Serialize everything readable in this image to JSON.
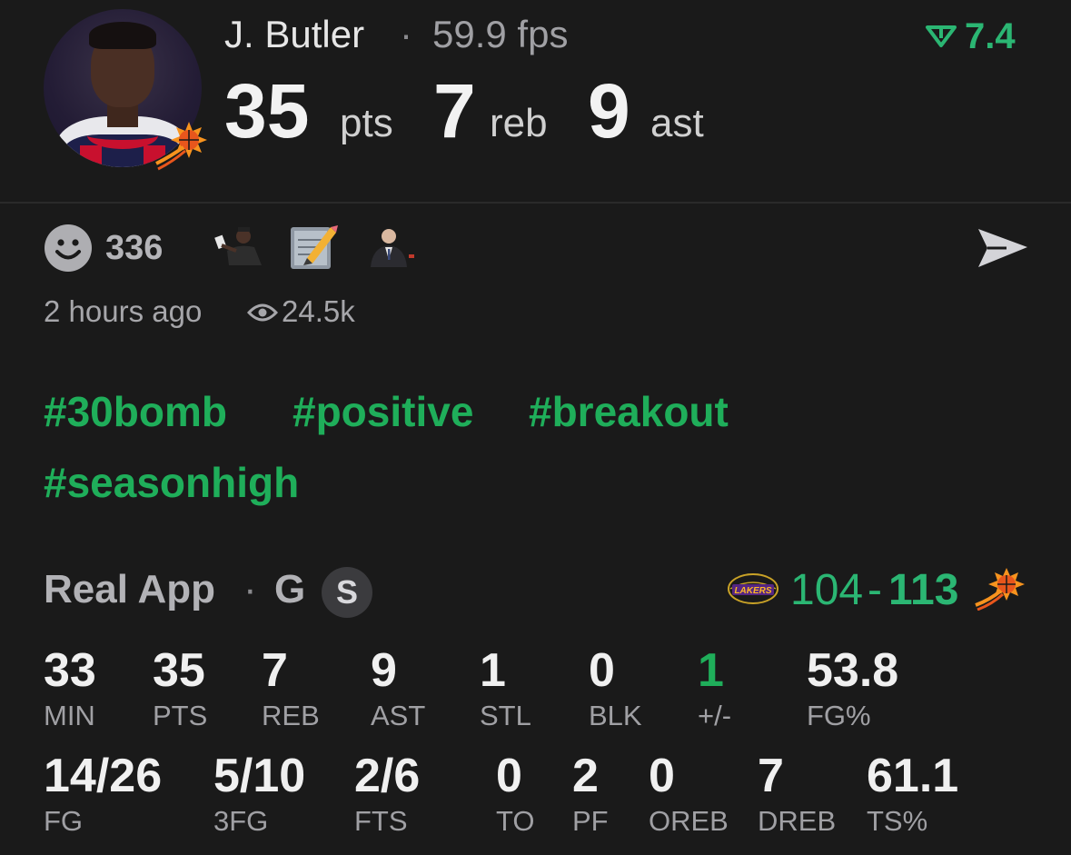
{
  "player": {
    "name": "J. Butler",
    "fps": "59.9 fps",
    "pts": "35",
    "pts_unit": "pts",
    "reb": "7",
    "reb_unit": "reb",
    "ast": "9",
    "ast_unit": "ast"
  },
  "rating": "7.4",
  "reactions": {
    "count": "336",
    "icons": [
      "smiley-icon",
      "player-reaction-emoji",
      "memo-emoji",
      "commissioner-emoji"
    ]
  },
  "meta": {
    "time_ago": "2 hours ago",
    "views": "24.5k"
  },
  "hashtags": [
    "#30bomb",
    "#positive",
    "#breakout",
    "#seasonhigh"
  ],
  "game": {
    "league": "Real App",
    "position": "G",
    "badge": "S",
    "away_team_logo": "lakers-logo",
    "away_score": "104",
    "dash": "-",
    "home_score": "113",
    "home_team_logo": "suns-logo"
  },
  "stats_row1": [
    {
      "value": "33",
      "label": "MIN"
    },
    {
      "value": "35",
      "label": "PTS"
    },
    {
      "value": "7",
      "label": "REB"
    },
    {
      "value": "9",
      "label": "AST"
    },
    {
      "value": "1",
      "label": "STL"
    },
    {
      "value": "0",
      "label": "BLK"
    },
    {
      "value": "1",
      "label": "+/-"
    },
    {
      "value": "53.8",
      "label": "FG%"
    }
  ],
  "stats_row2": [
    {
      "value": "14/26",
      "label": "FG"
    },
    {
      "value": "5/10",
      "label": "3FG"
    },
    {
      "value": "2/6",
      "label": "FTS"
    },
    {
      "value": "0",
      "label": "TO"
    },
    {
      "value": "2",
      "label": "PF"
    },
    {
      "value": "0",
      "label": "OREB"
    },
    {
      "value": "7",
      "label": "DREB"
    },
    {
      "value": "61.1",
      "label": "TS%"
    }
  ],
  "colors": {
    "background": "#1a1a1a",
    "accent_green": "#1fae5a",
    "score_green": "#2bb673"
  }
}
